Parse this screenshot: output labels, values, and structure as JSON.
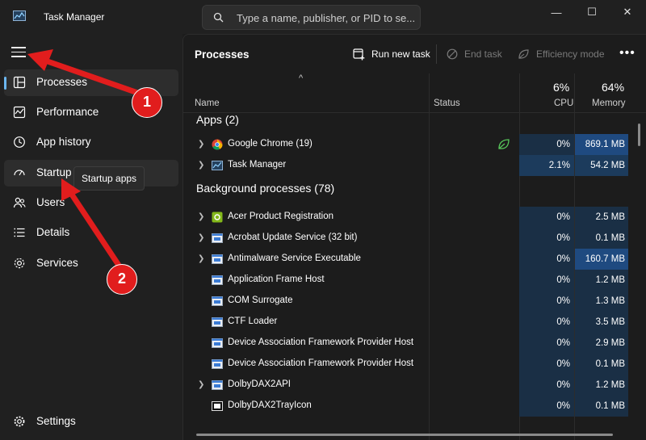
{
  "window": {
    "title": "Task Manager",
    "controls": {
      "minimize": "—",
      "maximize": "☐",
      "close": "✕"
    }
  },
  "search": {
    "placeholder": "Type a name, publisher, or PID to se..."
  },
  "sidebar": {
    "items": [
      {
        "label": "Processes",
        "icon": "processes-icon",
        "selected": true
      },
      {
        "label": "Performance",
        "icon": "performance-icon"
      },
      {
        "label": "App history",
        "icon": "app-history-icon"
      },
      {
        "label": "Startup",
        "icon": "startup-icon",
        "hover": true
      },
      {
        "label": "Users",
        "icon": "users-icon"
      },
      {
        "label": "Details",
        "icon": "details-icon"
      },
      {
        "label": "Services",
        "icon": "services-icon"
      }
    ],
    "settings_label": "Settings",
    "tooltip": "Startup apps"
  },
  "toolbar": {
    "page_title": "Processes",
    "run_new_task": "Run new task",
    "end_task": "End task",
    "efficiency_mode": "Efficiency mode",
    "more": "•••"
  },
  "columns": {
    "sort_arrow": "^",
    "name": "Name",
    "status": "Status",
    "cpu_pct": "6%",
    "cpu": "CPU",
    "memory_pct": "64%",
    "memory": "Memory"
  },
  "groups": [
    {
      "title": "Apps (2)",
      "rows": [
        {
          "name": "Google Chrome (19)",
          "cpu": "0%",
          "memory": "869.1 MB",
          "expandable": true,
          "icon": "chrome-icon",
          "status_icon": "efficiency-leaf-icon"
        },
        {
          "name": "Task Manager",
          "cpu": "2.1%",
          "memory": "54.2 MB",
          "expandable": true,
          "icon": "task-manager-icon"
        }
      ]
    },
    {
      "title": "Background processes (78)",
      "rows": [
        {
          "name": "Acer Product Registration",
          "cpu": "0%",
          "memory": "2.5 MB",
          "expandable": true,
          "icon": "acer-icon"
        },
        {
          "name": "Acrobat Update Service (32 bit)",
          "cpu": "0%",
          "memory": "0.1 MB",
          "expandable": true,
          "icon": "window-icon"
        },
        {
          "name": "Antimalware Service Executable",
          "cpu": "0%",
          "memory": "160.7 MB",
          "expandable": true,
          "icon": "window-icon"
        },
        {
          "name": "Application Frame Host",
          "cpu": "0%",
          "memory": "1.2 MB",
          "expandable": false,
          "icon": "window-icon"
        },
        {
          "name": "COM Surrogate",
          "cpu": "0%",
          "memory": "1.3 MB",
          "expandable": false,
          "icon": "window-icon"
        },
        {
          "name": "CTF Loader",
          "cpu": "0%",
          "memory": "3.5 MB",
          "expandable": false,
          "icon": "window-icon"
        },
        {
          "name": "Device Association Framework Provider Host",
          "cpu": "0%",
          "memory": "2.9 MB",
          "expandable": false,
          "icon": "window-icon"
        },
        {
          "name": "Device Association Framework Provider Host",
          "cpu": "0%",
          "memory": "0.1 MB",
          "expandable": false,
          "icon": "window-icon"
        },
        {
          "name": "DolbyDAX2API",
          "cpu": "0%",
          "memory": "1.2 MB",
          "expandable": true,
          "icon": "window-icon"
        },
        {
          "name": "DolbyDAX2TrayIcon",
          "cpu": "0%",
          "memory": "0.1 MB",
          "expandable": false,
          "icon": "dolby-icon"
        }
      ]
    }
  ],
  "annotations": {
    "callout_1": "1",
    "callout_2": "2"
  },
  "colors": {
    "accent": "#6cb7f0",
    "heat_light": "#1a2f45",
    "heat_medium": "#1c3b5c",
    "heat_strong": "#1f4a80",
    "annotation_red": "#e11d1d"
  }
}
